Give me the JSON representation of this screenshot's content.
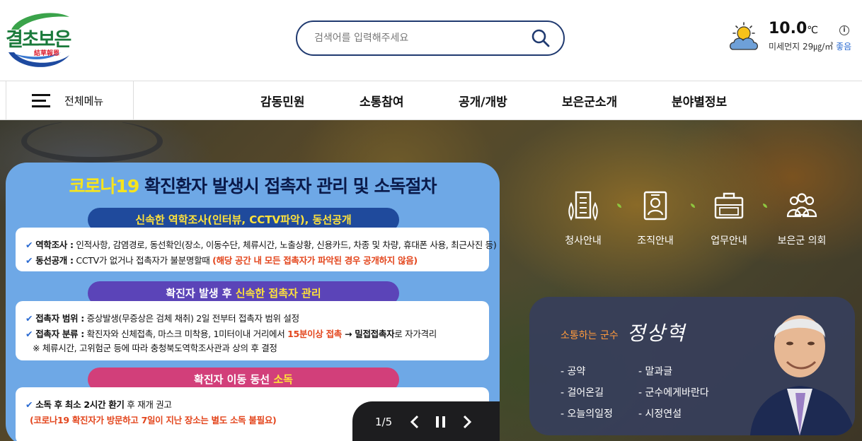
{
  "header": {
    "logo": {
      "text_main": "결초보은",
      "text_sub": "結草報恩"
    },
    "search": {
      "placeholder": "검색어를 입력해주세요"
    },
    "weather": {
      "temperature": "10.0",
      "unit": "℃",
      "dust_label": "미세먼지 29㎍/㎥",
      "dust_status": "좋음",
      "icon": "sun-cloud-icon"
    }
  },
  "nav": {
    "all_menu_label": "전체메뉴",
    "items": [
      "감동민원",
      "소통참여",
      "공개/개방",
      "보은군소개",
      "분야별정보"
    ]
  },
  "notice": {
    "title_part1": "코로나19",
    "title_part2": " 확진환자 발생시 접촉자 관리 및 소독절차",
    "section1": {
      "pill": "신속한 역학조사(인터뷰, CCTV파악), 동선공개",
      "line1_label": "역학조사 :",
      "line1_text": " 인적사항, 감염경로, 동선확인(장소, 이동수단, 체류시간, 노출상황, 신용카드, 차종 및 차량, 휴대폰 사용, 최근사진 등)",
      "line2_label": "동선공개 :",
      "line2_text": " CCTV가 없거나 접촉자가 불분명할때 ",
      "line2_red": "(해당 공간 내 모든 접촉자가 파악된 경우 공개하지 않음)"
    },
    "section2": {
      "pill_white": "확진자 발생 후 ",
      "pill_yellow": "신속한 접촉자 관리",
      "line1_label": "접촉자 범위 :",
      "line1_text": " 증상발생(무증상은 검체 채취) 2일 전부터 접촉자 범위 설정",
      "line2_label": "접촉자 분류 :",
      "line2_text": " 확진자와 신체접촉, 마스크 미착용, 1미터이내 거리에서 ",
      "line2_red": "15분이상 접촉",
      "line2_arrow": " → ",
      "line2_bold": "밀접접촉자",
      "line2_tail": "로 자가격리",
      "line3": "※ 체류시간, 고위험군 등에 따라 충청북도역학조사관과 상의 후 결정"
    },
    "section3": {
      "pill_white": "확진자 이동 동선 ",
      "pill_yellow": "소독",
      "line1_bold": "소독 후 최소 2시간 환기",
      "line1_text": " 후 재개 권고",
      "line2_red": "(코로나19 확진자가 방문하고 7일이 지난 장소는 별도 소독 불필요)"
    }
  },
  "slider": {
    "current": "1/5"
  },
  "quick_links": [
    {
      "label": "청사안내",
      "icon": "building-icon"
    },
    {
      "label": "조직안내",
      "icon": "id-card-icon"
    },
    {
      "label": "업무안내",
      "icon": "briefcase-icon"
    },
    {
      "label": "보은군 의회",
      "icon": "group-icon"
    }
  ],
  "governor": {
    "label": "소통하는 군수",
    "name": "정상혁",
    "links_left": [
      "공약",
      "걸어온길",
      "오늘의일정"
    ],
    "links_right": [
      "말과글",
      "군수에게바란다",
      "시정연설"
    ]
  },
  "colors": {
    "brand_navy": "#203a70",
    "notice_bg": "#6ea8e6",
    "pill_navy": "#1f4a9c",
    "pill_purple": "#5b44b8",
    "pill_pink": "#d23f7a",
    "accent_orange": "#ff9a3c"
  }
}
